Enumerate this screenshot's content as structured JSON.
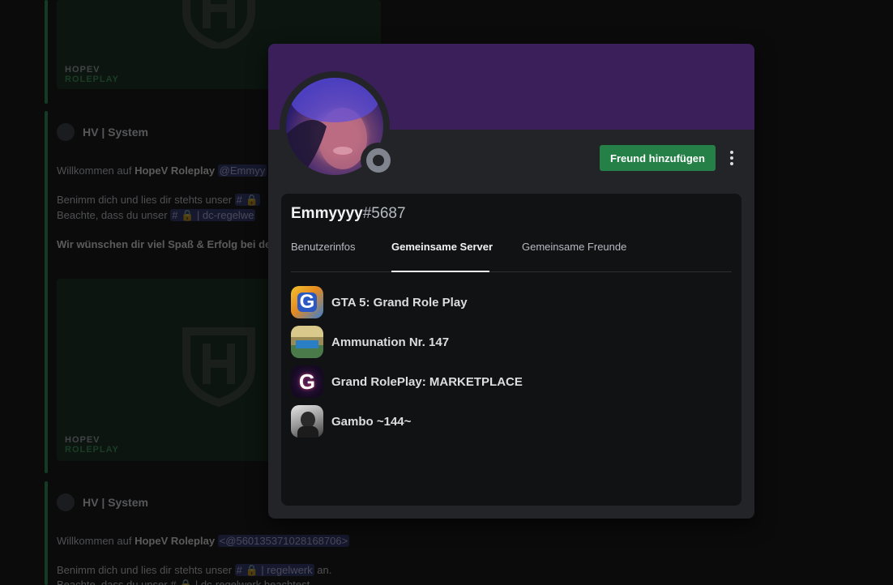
{
  "background": {
    "embed_brand_top": "HOPEV",
    "embed_brand_bottom": "ROLEPLAY",
    "messages": [
      {
        "author": "HV | System",
        "welcome_prefix": "Willkommen auf ",
        "welcome_server": "HopeV Roleplay",
        "welcome_mention": "@Emmyy",
        "rules_text": "Benimm dich und lies dir stehts unser",
        "rules_channel": "# 🔒",
        "note_text": "Beachte, dass du unser",
        "note_channel": "# 🔒 | dc-regelwe",
        "wish_text": "Wir wünschen dir viel Spaß & Erfolg bei de"
      },
      {
        "author": "HV | System",
        "welcome_prefix": "Willkommen auf ",
        "welcome_server": "HopeV Roleplay",
        "welcome_mention": "<@560135371028168706>",
        "rules_text": "Benimm dich und lies dir stehts unser",
        "rules_channel": "# 🔒 | regelwerk",
        "rules_suffix": " an.",
        "note_text": "Beachte, dass du unser # 🔒 | dc-regelwerk beachtest."
      }
    ]
  },
  "profile": {
    "username": "Emmyyyy",
    "discriminator": "#5687",
    "status_icon": "offline-status-icon",
    "add_friend_label": "Freund hinzufügen",
    "more_icon": "more-vertical-icon",
    "banner_color": "#3b1f5b",
    "tabs": [
      {
        "label": "Benutzerinfos",
        "active": false
      },
      {
        "label": "Gemeinsame Server",
        "active": true
      },
      {
        "label": "Gemeinsame Freunde",
        "active": false
      }
    ],
    "mutual_servers": [
      {
        "name": "GTA 5: Grand Role Play",
        "icon": "grand-rp-icon"
      },
      {
        "name": "Ammunation Nr. 147",
        "icon": "ammunation-icon"
      },
      {
        "name": "Grand RolePlay: MARKETPLACE",
        "icon": "grand-rp-marketplace-icon"
      },
      {
        "name": "Gambo ~144~",
        "icon": "gambo-icon"
      }
    ]
  },
  "colors": {
    "accent_green": "#248046",
    "status_offline": "#80848e",
    "panel": "#232428",
    "inner_panel": "#111214"
  }
}
